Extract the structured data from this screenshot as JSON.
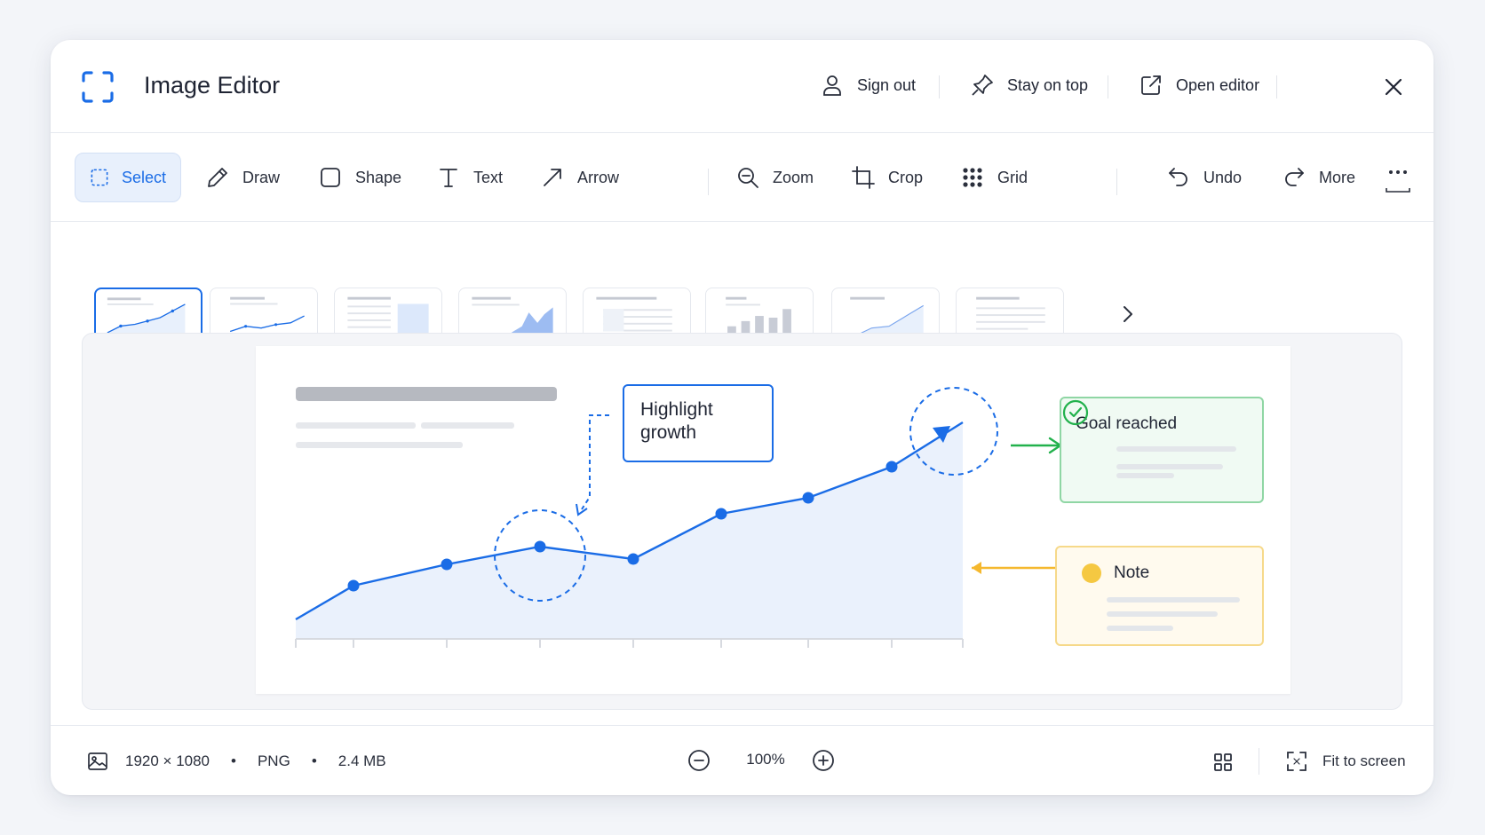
{
  "window": {
    "title": "Image Editor"
  },
  "titlebar": {
    "sign_out": "Sign out",
    "stay_on_top": "Stay on top",
    "open_editor": "Open editor"
  },
  "toolbar": {
    "tools": [
      {
        "label": "Select",
        "icon": "select-icon",
        "active": true
      },
      {
        "label": "Draw",
        "icon": "pencil-icon"
      },
      {
        "label": "Shape",
        "icon": "shape-icon"
      },
      {
        "label": "Text",
        "icon": "text-icon"
      },
      {
        "label": "Arrow",
        "icon": "arrow-icon"
      },
      {
        "label": "Zoom",
        "icon": "zoom-icon"
      },
      {
        "label": "Crop",
        "icon": "crop-icon"
      },
      {
        "label": "Grid",
        "icon": "grid-icon"
      },
      {
        "label": "Undo",
        "icon": "undo-icon"
      },
      {
        "label": "More",
        "icon": "redo-icon"
      }
    ]
  },
  "canvas": {
    "callout": "Highlight growth",
    "goal_card": "Goal reached",
    "note_card": "Note"
  },
  "status": {
    "dimensions": "1920 × 1080",
    "format": "PNG",
    "size": "2.4 MB",
    "zoom": "100%",
    "fit_to_screen": "Fit to screen"
  },
  "colors": {
    "accent": "#1a6ce6",
    "success": "#22b14c",
    "warning": "#f5b82e"
  }
}
